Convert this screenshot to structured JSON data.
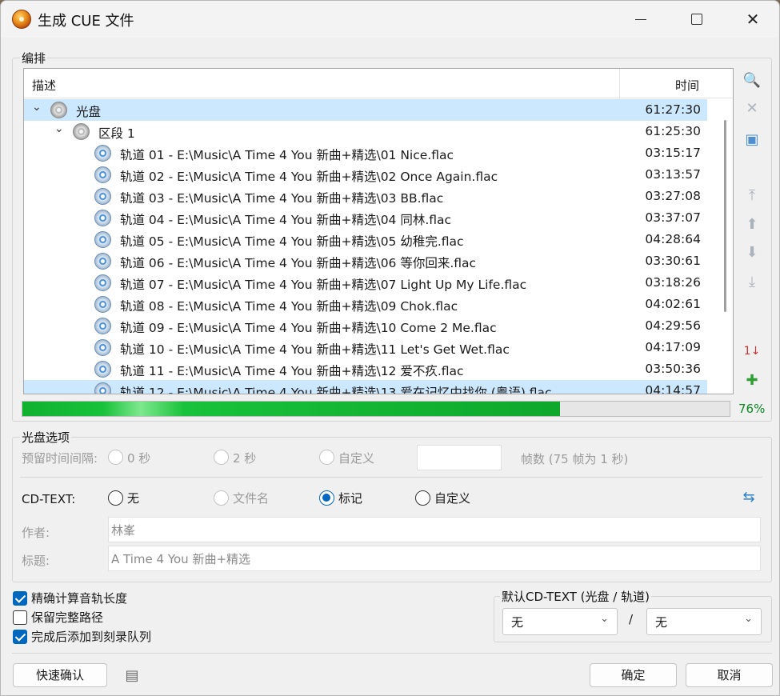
{
  "window": {
    "title": "生成 CUE 文件"
  },
  "arrange": {
    "label": "编排",
    "columns": {
      "desc": "描述",
      "time": "时间"
    },
    "rows": [
      {
        "label": "光盘",
        "time": "61:27:30",
        "level": 0,
        "type": "disc"
      },
      {
        "label": "区段 1",
        "time": "61:25:30",
        "level": 1,
        "type": "disc"
      },
      {
        "label": "轨道 01 - E:\\Music\\A Time 4 You 新曲+精选\\01 Nice.flac",
        "time": "03:15:17",
        "level": 2,
        "type": "track"
      },
      {
        "label": "轨道 02 - E:\\Music\\A Time 4 You 新曲+精选\\02 Once Again.flac",
        "time": "03:13:57",
        "level": 2,
        "type": "track"
      },
      {
        "label": "轨道 03 - E:\\Music\\A Time 4 You 新曲+精选\\03 BB.flac",
        "time": "03:27:08",
        "level": 2,
        "type": "track"
      },
      {
        "label": "轨道 04 - E:\\Music\\A Time 4 You 新曲+精选\\04 同林.flac",
        "time": "03:37:07",
        "level": 2,
        "type": "track"
      },
      {
        "label": "轨道 05 - E:\\Music\\A Time 4 You 新曲+精选\\05 幼稚完.flac",
        "time": "04:28:64",
        "level": 2,
        "type": "track"
      },
      {
        "label": "轨道 06 - E:\\Music\\A Time 4 You 新曲+精选\\06 等你回来.flac",
        "time": "03:30:61",
        "level": 2,
        "type": "track"
      },
      {
        "label": "轨道 07 - E:\\Music\\A Time 4 You 新曲+精选\\07 Light Up My Life.flac",
        "time": "03:18:26",
        "level": 2,
        "type": "track"
      },
      {
        "label": "轨道 08 - E:\\Music\\A Time 4 You 新曲+精选\\09 Chok.flac",
        "time": "04:02:61",
        "level": 2,
        "type": "track"
      },
      {
        "label": "轨道 09 - E:\\Music\\A Time 4 You 新曲+精选\\10 Come 2 Me.flac",
        "time": "04:29:56",
        "level": 2,
        "type": "track"
      },
      {
        "label": "轨道 10 - E:\\Music\\A Time 4 You 新曲+精选\\11 Let's Get Wet.flac",
        "time": "04:17:09",
        "level": 2,
        "type": "track"
      },
      {
        "label": "轨道 11 - E:\\Music\\A Time 4 You 新曲+精选\\12 爱不疚.flac",
        "time": "03:50:36",
        "level": 2,
        "type": "track"
      },
      {
        "label": "轨道 12 - E:\\Music\\A Time 4 You 新曲+精选\\13 爱在记忆中找你 (粤语).flac",
        "time": "04:14:57",
        "level": 2,
        "type": "track"
      }
    ],
    "progress_percent": 76,
    "progress_text": "76%"
  },
  "disc_options": {
    "label": "光盘选项",
    "pregap_label": "预留时间间隔:",
    "pregap_options": [
      "0 秒",
      "2 秒",
      "自定义"
    ],
    "frames_hint": "帧数 (75 帧为 1 秒)",
    "cdtext_label": "CD-TEXT:",
    "cdtext_options": [
      "无",
      "文件名",
      "标记",
      "自定义"
    ],
    "cdtext_selected": "标记",
    "author_label": "作者:",
    "author_value": "林峯",
    "title_label": "标题:",
    "title_value": "A Time 4 You 新曲+精选"
  },
  "checks": {
    "exact_length": "精确计算音轨长度",
    "keep_path": "保留完整路径",
    "add_queue": "完成后添加到刻录队列"
  },
  "default_cdtext": {
    "label": "默认CD-TEXT (光盘 / 轨道)",
    "disc_value": "无",
    "separator": "/",
    "track_value": "无"
  },
  "buttons": {
    "quick_confirm": "快速确认",
    "ok": "确定",
    "cancel": "取消"
  }
}
